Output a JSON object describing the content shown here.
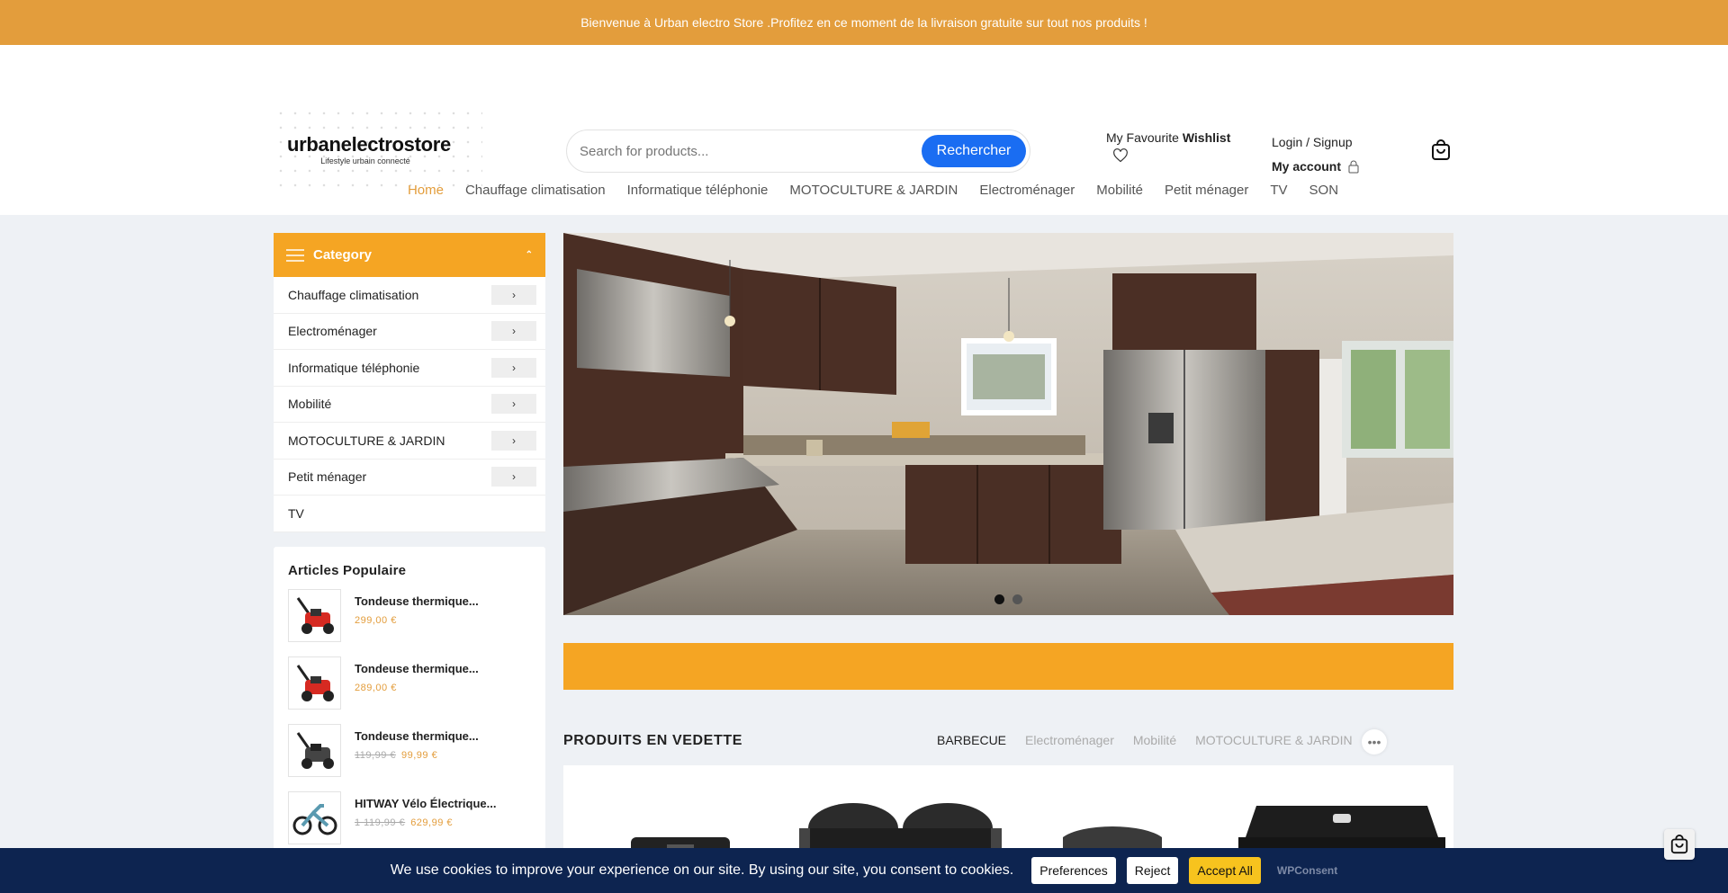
{
  "topbar": {
    "text": "Bienvenue à Urban electro Store .Profitez en ce moment de la livraison gratuite sur tout nos produits !"
  },
  "logo": {
    "name": "urbanelectrostore",
    "tagline": "Lifestyle urbain connecté"
  },
  "search": {
    "placeholder": "Search for products...",
    "button": "Rechercher"
  },
  "wishlist": {
    "prefix": "My Favourite ",
    "label": "Wishlist"
  },
  "account": {
    "login": "Login / Signup",
    "label": "My account"
  },
  "nav": [
    "Home",
    "Chauffage climatisation",
    "Informatique téléphonie",
    "MOTOCULTURE & JARDIN",
    "Electroménager",
    "Mobilité",
    "Petit ménager",
    "TV",
    "SON"
  ],
  "category": {
    "title": "Category",
    "items": [
      "Chauffage climatisation",
      "Electroménager",
      "Informatique téléphonie",
      "Mobilité",
      "MOTOCULTURE & JARDIN",
      "Petit ménager",
      "TV"
    ]
  },
  "popular": {
    "title": "Articles Populaire",
    "items": [
      {
        "name": "Tondeuse thermique...",
        "old_price": "",
        "price": "299,00 €"
      },
      {
        "name": "Tondeuse thermique...",
        "old_price": "",
        "price": "289,00 €"
      },
      {
        "name": "Tondeuse thermique...",
        "old_price": "119,99 €",
        "price": "99,99 €"
      },
      {
        "name": "HITWAY Vélo Électrique...",
        "old_price": "1 119,99 €",
        "price": "629,99 €"
      }
    ]
  },
  "featured": {
    "title": "PRODUITS EN VEDETTE",
    "tabs": [
      "BARBECUE",
      "Electroménager",
      "Mobilité",
      "MOTOCULTURE & JARDIN"
    ]
  },
  "cookie": {
    "message": "We use cookies to improve your experience on our site. By using our site, you consent to cookies.",
    "preferences": "Preferences",
    "reject": "Reject",
    "accept": "Accept All",
    "brand": "WPConsent"
  },
  "colors": {
    "accent": "#f5a523",
    "topbar": "#e39d3c",
    "primary_button": "#1a6df2",
    "cookie_bar": "#0d2450"
  }
}
